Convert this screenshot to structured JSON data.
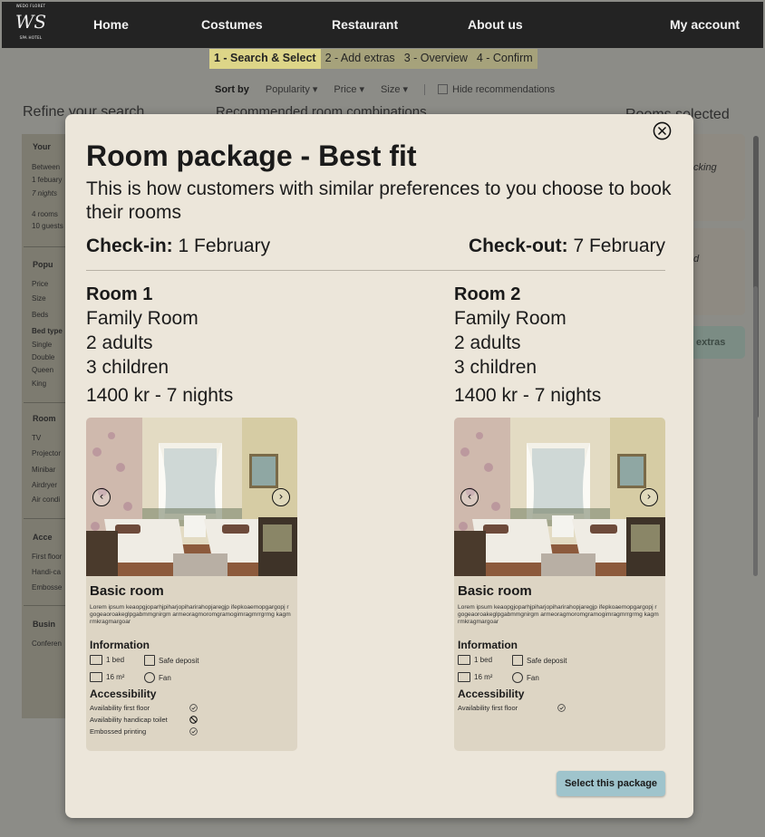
{
  "nav": {
    "logo_top": "WEDO FLORET",
    "logo_mark": "WS",
    "logo_bottom": "SPA HOTEL",
    "items": [
      "Home",
      "Costumes",
      "Restaurant",
      "About us"
    ],
    "account": "My account"
  },
  "steps": [
    "1 - Search & Select",
    "2 - Add extras",
    "3 - Overview",
    "4 - Confirm"
  ],
  "sortbar": {
    "label": "Sort by",
    "options": [
      "Popularity",
      "Price",
      "Size"
    ],
    "hide_label": "Hide recommendations"
  },
  "background": {
    "refine": "Refine your search",
    "recommended": "Recommended room combinations",
    "rooms_selected": "Rooms selected",
    "right_card_text_1": "cking",
    "right_card_text_2": "d",
    "extras_label": "extras",
    "sidebar": {
      "your": "Your",
      "between": "Between",
      "dates": "1 febuary",
      "nights": "7 nights",
      "rooms": "4 rooms",
      "guests": "10 guests",
      "popular": "Popu",
      "price": "Price",
      "size": "Size",
      "beds": "Beds",
      "bed_type": "Bed type",
      "single": "Single",
      "double": "Double",
      "queen": "Queen",
      "king": "King",
      "room": "Room",
      "tv": "TV",
      "projector": "Projector",
      "minibar": "Minibar",
      "airdryer": "Airdryer",
      "aircond": "Air condi",
      "access": "Acce",
      "first_floor": "First floor",
      "handicap": "Handi-ca",
      "embossed": "Embosse",
      "business": "Busin",
      "conference": "Conferen"
    }
  },
  "modal": {
    "title": "Room package - Best fit",
    "subtitle": "This is how customers with similar preferences to you choose to book their rooms",
    "checkin_label": "Check-in:",
    "checkin_value": "1 February",
    "checkout_label": "Check-out:",
    "checkout_value": "7 February",
    "select_button": "Select this package",
    "rooms": [
      {
        "heading": "Room 1",
        "type": "Family Room",
        "adults": "2 adults",
        "children": "3 children",
        "price": "1400 kr - 7 nights",
        "card_title": "Basic room",
        "lorem": "Lorem ipsum keaopgjoparhjpiharjopiharirahopjaregjp ifepkoaemopgargopj rgogeaoroakeglpgabmmgnirgm armeoragmoromgramogimragmrrgrmg kagmrmkragmargoar",
        "info_heading": "Information",
        "features": [
          "1 bed",
          "Safe deposit",
          "16 m²",
          "Fan"
        ],
        "accessibility_heading": "Accessibility",
        "accessibility": [
          {
            "label": "Availability first floor",
            "status": "check"
          },
          {
            "label": "Availability handicap toilet",
            "status": "no"
          },
          {
            "label": "Embossed printing",
            "status": "check"
          }
        ]
      },
      {
        "heading": "Room 2",
        "type": "Family Room",
        "adults": "2 adults",
        "children": "3 children",
        "price": "1400 kr - 7 nights",
        "card_title": "Basic room",
        "lorem": "Lorem ipsum keaopgjoparhjpiharjopiharirahopjaregjp ifepkoaemopgargopj rgogeaoroakeglpgabmmgnirgm armeoragmoromgramogimragmrrgrmg kagmrmkragmargoar",
        "info_heading": "Information",
        "features": [
          "1 bed",
          "Safe deposit",
          "16 m²",
          "Fan"
        ],
        "accessibility_heading": "Accessibility",
        "accessibility": [
          {
            "label": "Availability first floor",
            "status": "check"
          }
        ]
      }
    ]
  }
}
